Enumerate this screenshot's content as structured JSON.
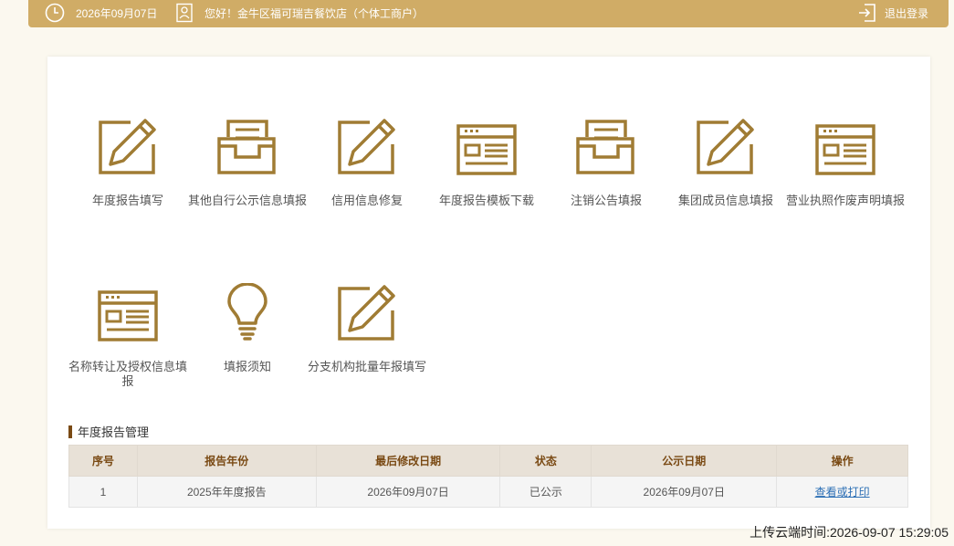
{
  "topbar": {
    "date": "2026年09月07日",
    "greeting": "您好！金牛区福可瑞吉餐饮店（个体工商户）",
    "logout_label": "退出登录"
  },
  "colors": {
    "topbar": "#d0ac66",
    "icon": "#a07c34",
    "header_text": "#7a4a14"
  },
  "menu": [
    {
      "label": "年度报告填写",
      "icon": "pen-edit-icon"
    },
    {
      "label": "其他自行公示信息填报",
      "icon": "inbox-tray-icon"
    },
    {
      "label": "信用信息修复",
      "icon": "pen-edit-icon"
    },
    {
      "label": "年度报告模板下载",
      "icon": "document-window-icon"
    },
    {
      "label": "注销公告填报",
      "icon": "inbox-tray-icon"
    },
    {
      "label": "集团成员信息填报",
      "icon": "pen-edit-icon"
    },
    {
      "label": "营业执照作废声明填报",
      "icon": "document-window-icon"
    },
    {
      "label": "名称转让及授权信息填报",
      "icon": "document-window-icon"
    },
    {
      "label": "填报须知",
      "icon": "lightbulb-icon"
    },
    {
      "label": "分支机构批量年报填写",
      "icon": "pen-edit-icon"
    }
  ],
  "section_title": "年度报告管理",
  "table": {
    "headers": [
      "序号",
      "报告年份",
      "最后修改日期",
      "状态",
      "公示日期",
      "操作"
    ],
    "rows": [
      [
        "1",
        "2025年年度报告",
        "2026年09月07日",
        "已公示",
        "2026年09月07日",
        "查看或打印"
      ]
    ]
  },
  "upload_time": "上传云端时间:2026-09-07 15:29:05"
}
